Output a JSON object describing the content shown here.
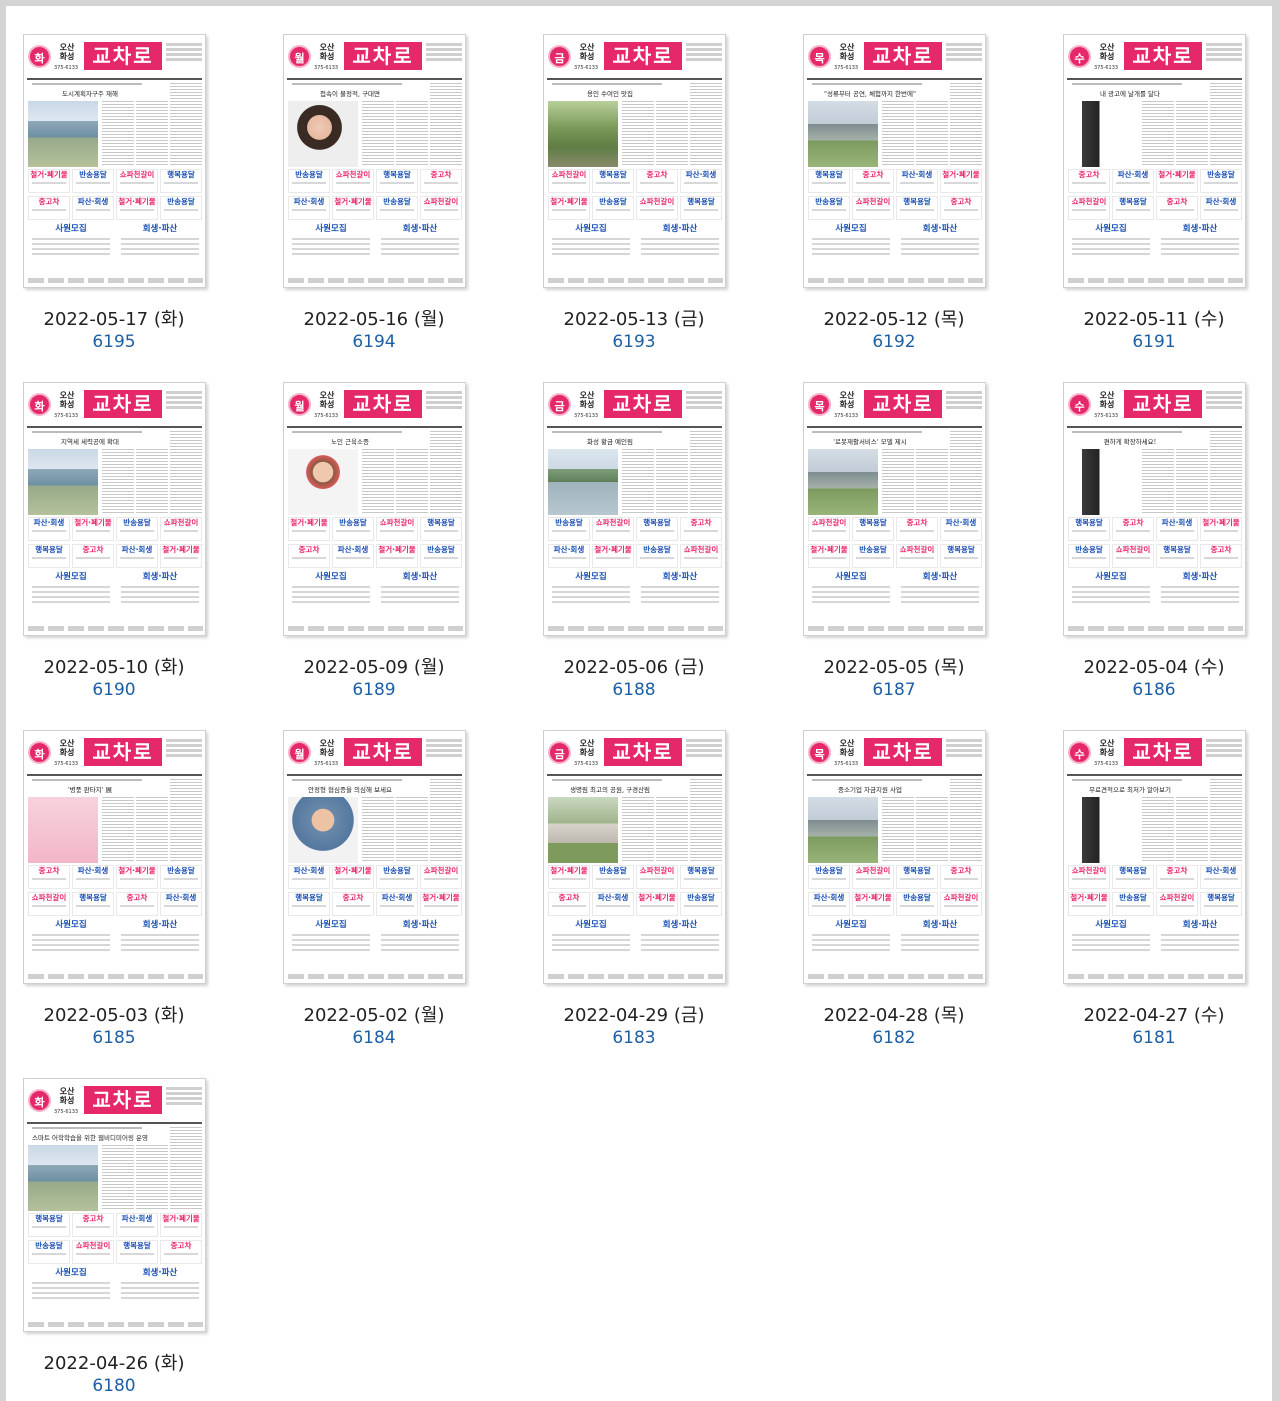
{
  "masthead": {
    "city_top": "오산",
    "city_bottom": "화성",
    "phone": "375-6133",
    "logo": "교차로"
  },
  "ads": {
    "labels": [
      "철거·폐기물",
      "반송용달",
      "쇼파천갈이",
      "행복용달",
      "중고차",
      "파산·회생",
      "사원모집",
      "회생·파산"
    ]
  },
  "issues": [
    {
      "date": "2022-05-17 (화)",
      "number": "6195",
      "day": "화",
      "headline": "도시계획자구주 재해",
      "photo": "building"
    },
    {
      "date": "2022-05-16 (월)",
      "number": "6194",
      "day": "월",
      "headline": "접속이 불정적, 구대면",
      "photo": "woman"
    },
    {
      "date": "2022-05-13 (금)",
      "number": "6193",
      "day": "금",
      "headline": "용인 수여인 맛집",
      "photo": "garden"
    },
    {
      "date": "2022-05-12 (목)",
      "number": "6192",
      "day": "목",
      "headline": "\"성류부터 공연, 체험까지 한번에\"",
      "photo": "campus"
    },
    {
      "date": "2022-05-11 (수)",
      "number": "6191",
      "day": "수",
      "headline": "내 광고에 날개를 달다",
      "photo": "phone"
    },
    {
      "date": "2022-05-10 (화)",
      "number": "6190",
      "day": "화",
      "headline": "지역세 세력공에 확대",
      "photo": "building"
    },
    {
      "date": "2022-05-09 (월)",
      "number": "6189",
      "day": "월",
      "headline": "노인 근육소증",
      "photo": "elder"
    },
    {
      "date": "2022-05-06 (금)",
      "number": "6188",
      "day": "금",
      "headline": "화성 황금 예인림",
      "photo": "river"
    },
    {
      "date": "2022-05-05 (목)",
      "number": "6187",
      "day": "목",
      "headline": "'로봇재활서비스' 모델 제시",
      "photo": "campus"
    },
    {
      "date": "2022-05-04 (수)",
      "number": "6186",
      "day": "수",
      "headline": "편하게 확장하세요!",
      "photo": "phone"
    },
    {
      "date": "2022-05-03 (화)",
      "number": "6185",
      "day": "화",
      "headline": "'병풍 판타지' 展",
      "photo": "pink"
    },
    {
      "date": "2022-05-02 (월)",
      "number": "6184",
      "day": "월",
      "headline": "안정형 협심증을 의심해 보세요",
      "photo": "man"
    },
    {
      "date": "2022-04-29 (금)",
      "number": "6183",
      "day": "금",
      "headline": "생명림 최고의 공원, 구경산림",
      "photo": "statue"
    },
    {
      "date": "2022-04-28 (목)",
      "number": "6182",
      "day": "목",
      "headline": "중소기업 자금지원 사업",
      "photo": "campus"
    },
    {
      "date": "2022-04-27 (수)",
      "number": "6181",
      "day": "수",
      "headline": "무료견적으로 최저가 알아보기",
      "photo": "phone"
    },
    {
      "date": "2022-04-26 (화)",
      "number": "6180",
      "day": "화",
      "headline": "스마트 어학학습을 위한 웹비디미어링 운영",
      "photo": "building"
    }
  ]
}
